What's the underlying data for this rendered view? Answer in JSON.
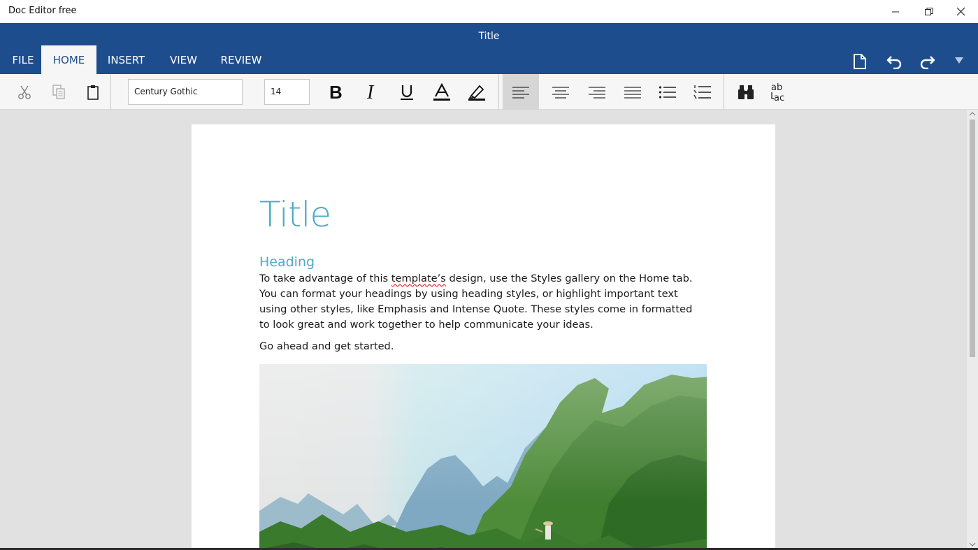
{
  "window": {
    "app_title": "Doc Editor free",
    "controls": [
      "minimize",
      "restore",
      "close"
    ]
  },
  "ribbon": {
    "document_title": "Title",
    "tabs": [
      {
        "label": "FILE",
        "active": false
      },
      {
        "label": "HOME",
        "active": true
      },
      {
        "label": "INSERT",
        "active": false
      },
      {
        "label": "VIEW",
        "active": false
      },
      {
        "label": "REVIEW",
        "active": false
      }
    ],
    "quick_actions": [
      "new-document-icon",
      "undo-icon",
      "redo-icon",
      "ribbon-collapse-icon"
    ]
  },
  "toolbar": {
    "font_family": "Century Gothic",
    "font_size": "14",
    "active_alignment": "left"
  },
  "document": {
    "title": "Title",
    "heading": "Heading",
    "paragraph_before": "To take advantage of this ",
    "paragraph_misspelled": "template’s",
    "paragraph_after": " design, use the Styles gallery on the Home tab. You can format your headings by using heading styles, or highlight important text using other styles, like Emphasis and Intense Quote. These styles come in formatted to look great and work together to help communicate your ideas.",
    "paragraph2": "Go ahead and get started."
  },
  "colors": {
    "ribbon_blue": "#1e4d8e",
    "accent_teal": "#4bacc6",
    "toolbar_bg": "#f6f6f6",
    "canvas_bg": "#e1e1e1"
  }
}
